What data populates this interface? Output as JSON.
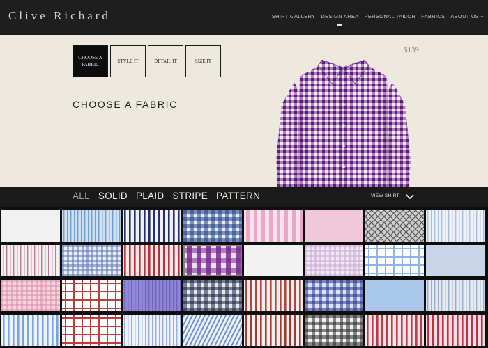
{
  "brand": {
    "name": "Clive Richard"
  },
  "nav": {
    "items": [
      {
        "label": "SHIRT GALLERY",
        "active": false
      },
      {
        "label": "DESIGN AREA",
        "active": true
      },
      {
        "label": "PERSONAL TAILOR",
        "active": false
      },
      {
        "label": "FABRICS",
        "active": false
      },
      {
        "label": "ABOUT US +",
        "active": false
      }
    ]
  },
  "steps": [
    {
      "label": "CHOOSE A FABRIC",
      "active": true
    },
    {
      "label": "STYLE IT",
      "active": false
    },
    {
      "label": "DETAIL IT",
      "active": false
    },
    {
      "label": "SIZE IT",
      "active": false
    }
  ],
  "section": {
    "title": "CHOOSE A FABRIC"
  },
  "product": {
    "price": "$139",
    "shirt_icon": "gingham-shirt-image"
  },
  "filters": {
    "items": [
      {
        "label": "ALL",
        "active": true
      },
      {
        "label": "SOLID",
        "active": false
      },
      {
        "label": "PLAID",
        "active": false
      },
      {
        "label": "STRIPE",
        "active": false
      },
      {
        "label": "PATTERN",
        "active": false
      }
    ],
    "view_shirt_label": "VIEW SHIRT",
    "view_shirt_icon": "chevron-down-icon"
  },
  "colors": {
    "header_bg": "#1e1e1e",
    "hero_bg": "#ede9df",
    "filterbar_bg": "#1a1a1a",
    "accent_purple": "#6d2a8a"
  },
  "swatches": {
    "columns": 8,
    "rows": 4,
    "items": [
      {
        "pattern": "solid",
        "bg": "#f1f1f2",
        "ink": "#e2e3e6"
      },
      {
        "pattern": "fine-stripe",
        "bg": "#cfe0f0",
        "ink": "#6e9dd0"
      },
      {
        "pattern": "stripe",
        "bg": "#f2f2f6",
        "ink": "#23306a"
      },
      {
        "pattern": "check",
        "bg": "#e8eef7",
        "ink": "#20428a"
      },
      {
        "pattern": "stripe-wide",
        "bg": "#f6e3ee",
        "ink": "#e8a8c6"
      },
      {
        "pattern": "solid",
        "bg": "#efc8d9",
        "ink": "#e6b3c9"
      },
      {
        "pattern": "diamond",
        "bg": "#cfcfcf",
        "ink": "#555555"
      },
      {
        "pattern": "fine-stripe",
        "bg": "#eef2f8",
        "ink": "#a8bede"
      },
      {
        "pattern": "fine-stripe",
        "bg": "#f4f0f2",
        "ink": "#b87a94"
      },
      {
        "pattern": "check-fine",
        "bg": "#e8edf8",
        "ink": "#5a6fb0"
      },
      {
        "pattern": "stripe",
        "bg": "#f6e6e6",
        "ink": "#b0343f"
      },
      {
        "pattern": "gingham-selected",
        "bg": "#ece2ee",
        "ink": "#7a2a92"
      },
      {
        "pattern": "solid",
        "bg": "#f3f3f4",
        "ink": "#e6e6e8"
      },
      {
        "pattern": "check-fine",
        "bg": "#f1e9f4",
        "ink": "#c8a6d6"
      },
      {
        "pattern": "window",
        "bg": "#ffffff",
        "ink": "#8cb4e6"
      },
      {
        "pattern": "solid",
        "bg": "#c9d6ea",
        "ink": "#b8c7e0"
      },
      {
        "pattern": "check-fine",
        "bg": "#f4d5df",
        "ink": "#d98aa2"
      },
      {
        "pattern": "window",
        "bg": "#ffffff",
        "ink": "#b2423e"
      },
      {
        "pattern": "fine-stripe",
        "bg": "#8f86d8",
        "ink": "#6f64c2"
      },
      {
        "pattern": "check",
        "bg": "#e6e8ee",
        "ink": "#1a2346"
      },
      {
        "pattern": "stripe",
        "bg": "#f3efef",
        "ink": "#b0453e"
      },
      {
        "pattern": "check",
        "bg": "#dde3f6",
        "ink": "#27378e"
      },
      {
        "pattern": "solid",
        "bg": "#aac6e8",
        "ink": "#96b6e0"
      },
      {
        "pattern": "fine-stripe",
        "bg": "#e4eaf2",
        "ink": "#9aaec8"
      },
      {
        "pattern": "stripe",
        "bg": "#eef3fb",
        "ink": "#7aa4dc"
      },
      {
        "pattern": "window",
        "bg": "#ffffff",
        "ink": "#c23a3a"
      },
      {
        "pattern": "fine-stripe",
        "bg": "#eef2fa",
        "ink": "#95aede"
      },
      {
        "pattern": "diag-stripe",
        "bg": "#eef3fb",
        "ink": "#6d91cf"
      },
      {
        "pattern": "stripe",
        "bg": "#f4eeec",
        "ink": "#a03c36"
      },
      {
        "pattern": "check",
        "bg": "#f0f0f0",
        "ink": "#2b2b2b"
      },
      {
        "pattern": "stripe",
        "bg": "#f4e6ea",
        "ink": "#c03a46"
      },
      {
        "pattern": "stripe",
        "bg": "#f6dfe6",
        "ink": "#c62e44"
      }
    ]
  }
}
